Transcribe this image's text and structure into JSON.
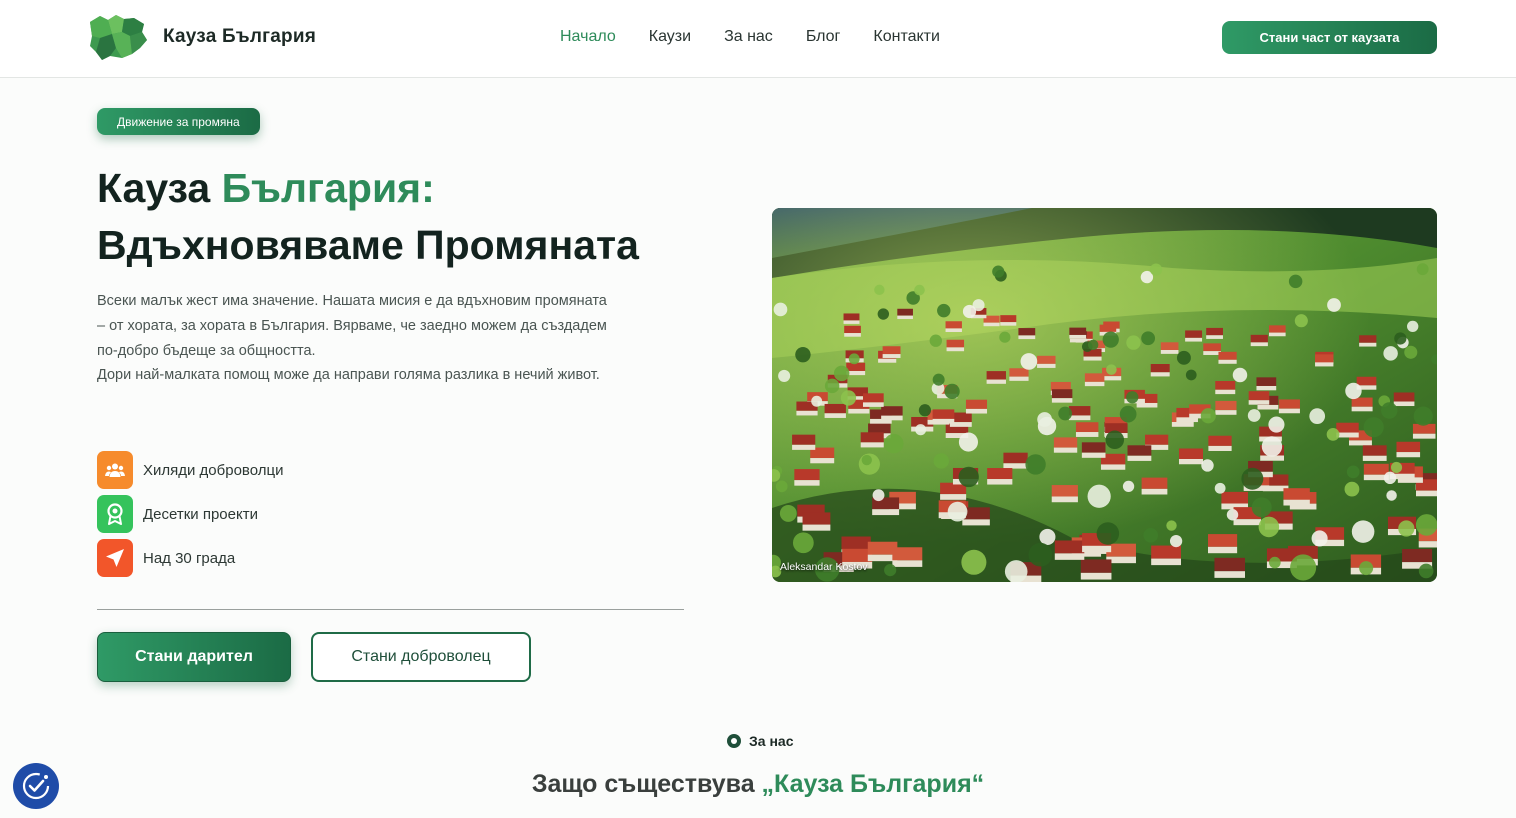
{
  "header": {
    "brand": "Кауза България",
    "nav": [
      "Начало",
      "Каузи",
      "За нас",
      "Блог",
      "Контакти"
    ],
    "cta": "Стани част от каузата"
  },
  "hero": {
    "tag": "Движение за промяна",
    "title_part1": "Кауза ",
    "title_accent": "България:",
    "title_line2": "Вдъхновяваме Промяната",
    "desc1": "Всеки малък жест има значение. Нашата мисия е да вдъхновим промяната – от хората, за хората в България. Вярваме, че заедно можем да създадем по-добро бъдеще за общността.",
    "desc2": "Дори най-малката помощ може да направи голяма разлика в нечий живот.",
    "features": [
      {
        "label": "Хиляди доброволци",
        "icon": "users-icon",
        "color": "#f68b2c"
      },
      {
        "label": "Десетки проекти",
        "icon": "award-icon",
        "color": "#35c35c"
      },
      {
        "label": "Над 30 града",
        "icon": "location-arrow-icon",
        "color": "#f2562a"
      }
    ],
    "btn_donor": "Стани дарител",
    "btn_volunteer": "Стани доброволец",
    "image_credit": "Aleksandar Kostov"
  },
  "about": {
    "tag": "За нас",
    "title_part1": "Защо съществува ",
    "title_accent": "„Кауза България“"
  },
  "colors": {
    "accent": "#2e8b5a",
    "accent_dark": "#1b6b45",
    "accessibility": "#1f4ca8"
  }
}
